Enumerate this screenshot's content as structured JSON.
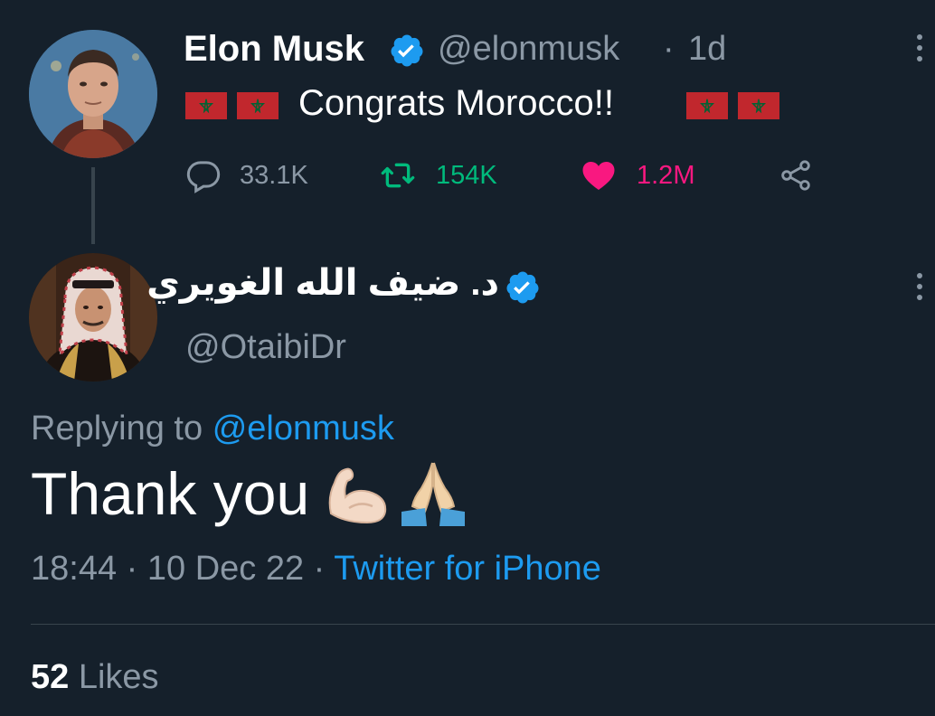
{
  "original_tweet": {
    "author_name": "Elon Musk",
    "handle": "@elonmusk",
    "separator": "·",
    "time_ago": "1d",
    "text": "Congrats Morocco!!",
    "reply_count": "33.1K",
    "retweet_count": "154K",
    "like_count": "1.2M"
  },
  "reply_tweet": {
    "author_name": "د. ضيف الله الغويري",
    "handle": "@OtaibiDr",
    "replying_prefix": "Replying to",
    "replying_to": "@elonmusk",
    "text": "Thank you",
    "time": "18:44",
    "dot1": "·",
    "date": "10 Dec 22",
    "dot2": "·",
    "source": "Twitter for iPhone",
    "likes_count": "52",
    "likes_label": "Likes"
  },
  "colors": {
    "background": "#15202b",
    "verified": "#1d9bf0",
    "retweet": "#00ba7c",
    "like": "#f91880",
    "muted": "#8b98a5",
    "flag_red": "#c1272d",
    "flag_green": "#006233"
  },
  "icons": {
    "verified": "verified-badge-icon",
    "reply": "reply-icon",
    "retweet": "retweet-icon",
    "like": "heart-icon",
    "share": "share-icon",
    "more": "more-vertical-icon",
    "flag": "morocco-flag-icon",
    "emoji_1": "flexed-biceps-emoji",
    "emoji_2": "folded-hands-emoji"
  }
}
